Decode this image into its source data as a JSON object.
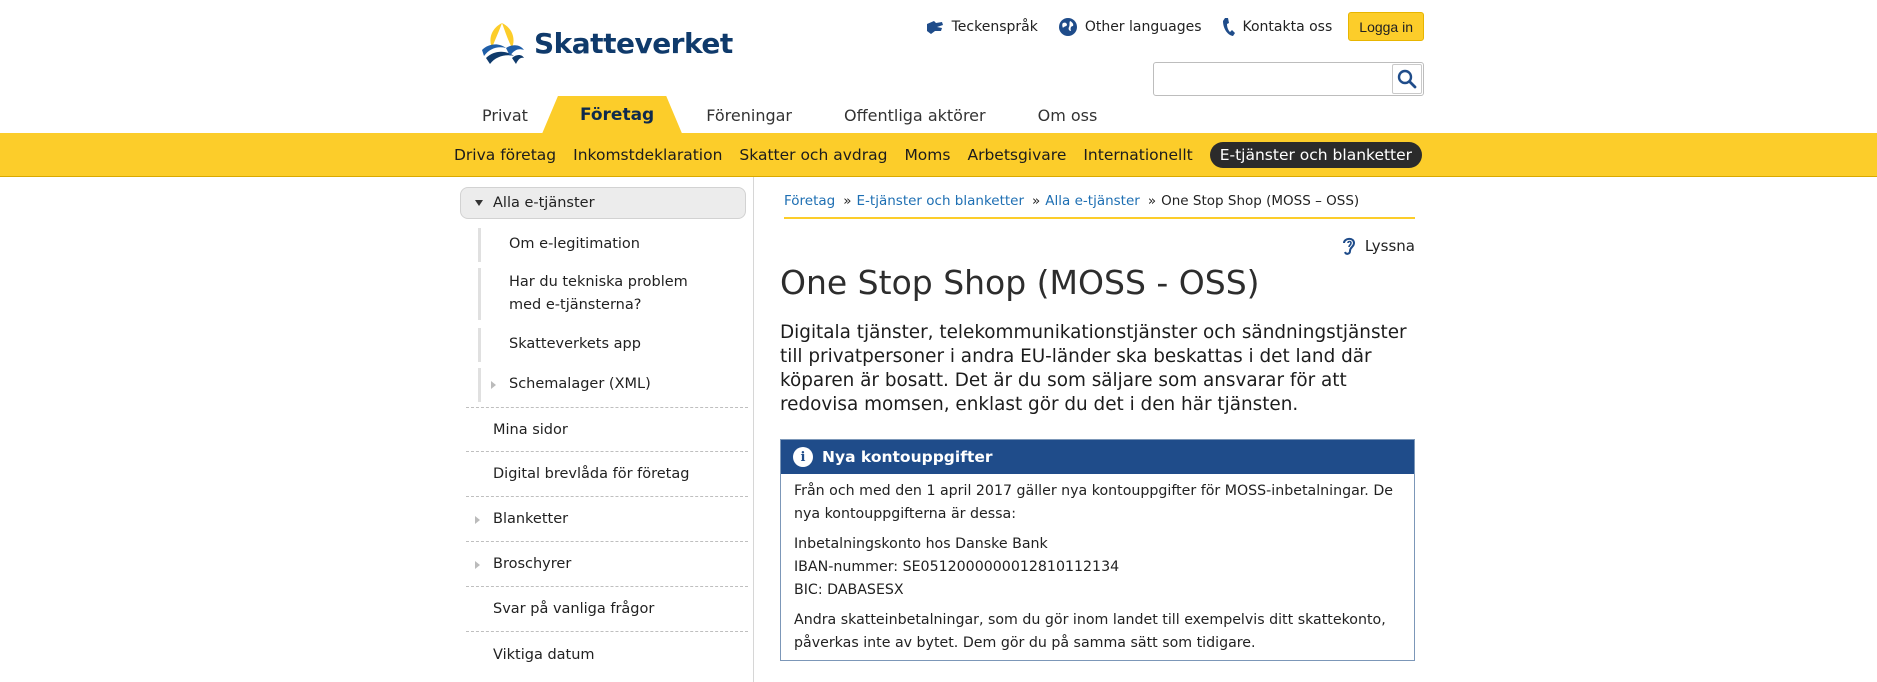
{
  "header": {
    "logo_text": "Skatteverket",
    "links": [
      {
        "label": "Teckenspråk",
        "icon": "sign-language-icon"
      },
      {
        "label": "Other languages",
        "icon": "globe-icon"
      },
      {
        "label": "Kontakta oss",
        "icon": "phone-icon"
      }
    ],
    "login_label": "Logga in",
    "search_placeholder": ""
  },
  "tabs": [
    "Privat",
    "Företag",
    "Föreningar",
    "Offentliga aktörer",
    "Om oss"
  ],
  "active_tab": "Företag",
  "subnav": [
    "Driva företag",
    "Inkomstdeklaration",
    "Skatter och avdrag",
    "Moms",
    "Arbetsgivare",
    "Internationellt",
    "E-tjänster och blanketter"
  ],
  "active_subnav": "E-tjänster och blanketter",
  "sidebar": {
    "top": "Alla e-tjänster",
    "sub_items": [
      "Om e-legitimation",
      "Har du tekniska problem med e-tjänsterna?",
      "Skatteverkets app",
      "Schemalager (XML)"
    ],
    "items": [
      "Mina sidor",
      "Digital brevlåda för företag",
      "Blanketter",
      "Broschyrer",
      "Svar på vanliga frågor",
      "Viktiga datum"
    ]
  },
  "breadcrumb": [
    "Företag",
    "E-tjänster och blanketter",
    "Alla e-tjänster",
    "One Stop Shop (MOSS – OSS)"
  ],
  "listen_label": "Lyssna",
  "page_title": "One Stop Shop (MOSS - OSS)",
  "lead": "Digitala tjänster, telekommunikationstjänster och sändningstjänster till privatpersoner i andra EU-länder ska beskattas i det land där köparen är bosatt. Det är du som säljare som ansvarar för att redovisa momsen, enklast gör du det i den här tjänsten.",
  "infobox": {
    "title": "Nya kontouppgifter",
    "p1": "Från och med den 1 april 2017 gäller nya kontouppgifter för MOSS-inbetalningar. De nya kontouppgifterna är dessa:",
    "account_line1": "Inbetalningskonto hos Danske Bank",
    "account_line2": "IBAN-nummer: SE0512000000012810112134",
    "account_line3": "BIC: DABASESX",
    "p3": "Andra skatteinbetalningar, som du gör inom landet till exempelvis ditt skattekonto, påverkas inte av bytet. Dem gör du på samma sätt som tidigare."
  },
  "colors": {
    "brand_yellow": "#fccd2a",
    "brand_blue": "#0f3a6b",
    "info_blue": "#1f4c8a",
    "link_blue": "#1e6fb3"
  }
}
